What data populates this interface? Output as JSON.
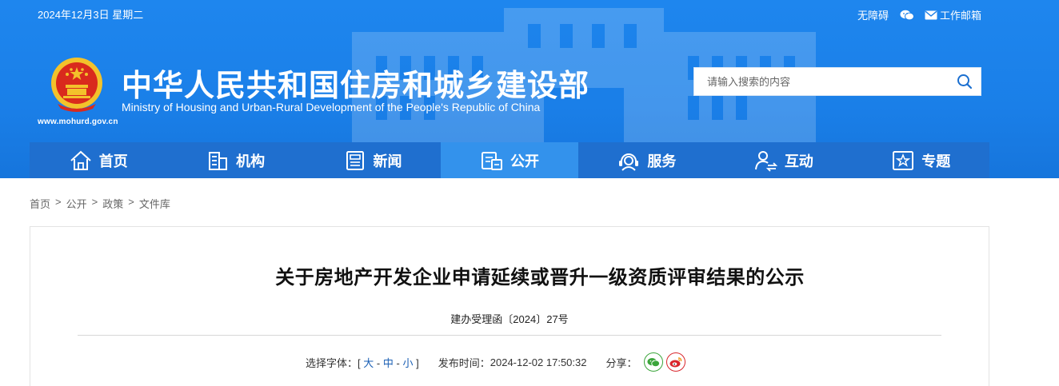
{
  "topbar": {
    "date": "2024年12月3日 星期二",
    "accessibility_label": "无障碍",
    "mail_label": "工作邮箱"
  },
  "site": {
    "title": "中华人民共和国住房和城乡建设部",
    "subtitle": "Ministry of Housing and Urban-Rural Development of the People's Republic of China",
    "url": "www.mohurd.gov.cn"
  },
  "search": {
    "placeholder": "请输入搜索的内容"
  },
  "nav": {
    "items": [
      {
        "label": "首页",
        "icon": "home-icon"
      },
      {
        "label": "机构",
        "icon": "building-icon"
      },
      {
        "label": "新闻",
        "icon": "news-icon"
      },
      {
        "label": "公开",
        "icon": "disclosure-icon",
        "active": true
      },
      {
        "label": "服务",
        "icon": "service-icon"
      },
      {
        "label": "互动",
        "icon": "interaction-icon"
      },
      {
        "label": "专题",
        "icon": "topic-icon"
      }
    ]
  },
  "breadcrumb": [
    "首页",
    "公开",
    "政策",
    "文件库"
  ],
  "article": {
    "title": "关于房地产开发企业申请延续或晋升一级资质评审结果的公示",
    "doc_number": "建办受理函〔2024〕27号",
    "font_size_label": "选择字体：",
    "font_open": "[",
    "font_large": "大",
    "font_medium": "中",
    "font_small": "小",
    "font_close": "]",
    "dash": "-",
    "publish_label": "发布时间：",
    "publish_time": "2024-12-02 17:50:32",
    "share_label": "分享："
  },
  "colors": {
    "header_blue": "#1a7fe8",
    "nav_blue": "#1f6fcf",
    "nav_active": "#3392ec",
    "link_blue": "#1a5fb4"
  }
}
